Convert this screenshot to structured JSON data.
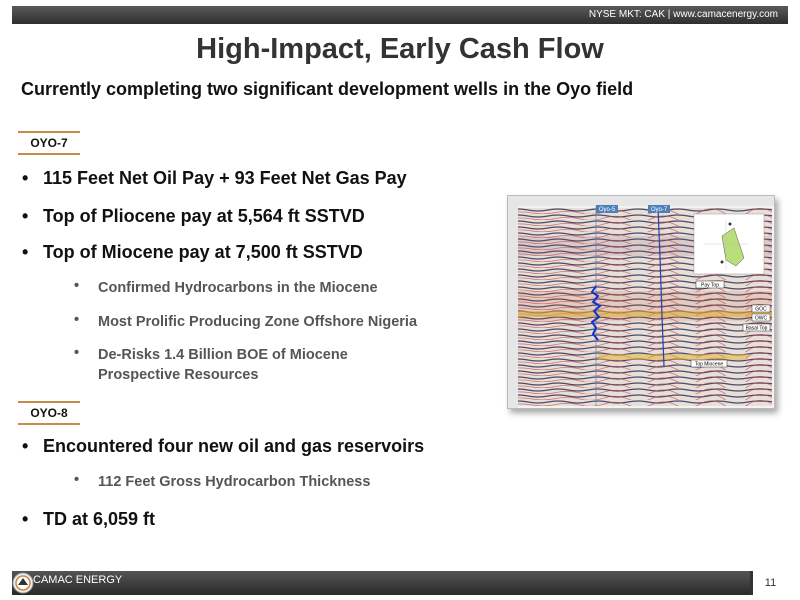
{
  "header": {
    "exchange_info": "NYSE MKT: CAK | www.camacenergy.com"
  },
  "title": "High-Impact, Early Cash Flow",
  "subtitle": "Currently completing two significant development wells in the Oyo field",
  "oyo7": {
    "tag": "OYO-7",
    "bullets": [
      "115 Feet Net Oil Pay + 93 Feet Net Gas Pay",
      "Top of Pliocene pay at 5,564 ft SSTVD",
      "Top of Miocene pay at 7,500 ft SSTVD"
    ],
    "sub_bullets": [
      "Confirmed Hydrocarbons in the Miocene",
      "Most Prolific Producing Zone Offshore Nigeria",
      "De-Risks 1.4 Billion BOE of Miocene",
      "Prospective Resources"
    ]
  },
  "oyo8": {
    "tag": "OYO-8",
    "bullets": [
      "Encountered four new oil and gas reservoirs",
      "TD at 6,059 ft"
    ],
    "sub_bullets": [
      "112 Feet Gross Hydrocarbon Thickness"
    ]
  },
  "figure": {
    "type": "seismic cross-section",
    "labels": [
      "Oyo-5",
      "Oyo-7",
      "Pay Top",
      "GOC",
      "OWC",
      "Top Miocene",
      "Basal Top"
    ]
  },
  "footer": {
    "company": "CAMAC ENERGY",
    "page_number": "11"
  },
  "colors": {
    "accent": "#c68b47",
    "bar": "#333333"
  }
}
